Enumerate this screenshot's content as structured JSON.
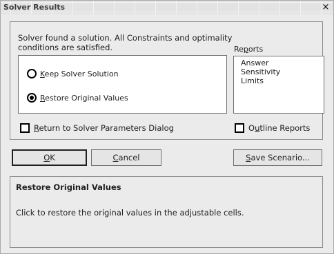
{
  "window": {
    "title": "Solver Results",
    "close_glyph": "×"
  },
  "message": {
    "line1": "Solver found a solution.  All Constraints and optimality",
    "line2": "conditions are satisfied."
  },
  "reports": {
    "label_pre": "Re",
    "label_accel": "p",
    "label_post": "orts",
    "items": [
      "Answer",
      "Sensitivity",
      "Limits"
    ]
  },
  "options": {
    "keep": {
      "accel": "K",
      "rest": "eep Solver Solution",
      "selected": false
    },
    "restore": {
      "accel": "R",
      "rest": "estore Original Values",
      "selected": true
    }
  },
  "checkboxes": {
    "return_dialog": {
      "pre": "",
      "accel": "R",
      "post": "eturn to Solver Parameters Dialog",
      "checked": false
    },
    "outline_reports": {
      "pre": "O",
      "accel": "u",
      "post": "tline Reports",
      "checked": false
    }
  },
  "buttons": {
    "ok": {
      "pre": "",
      "accel": "O",
      "post": "K"
    },
    "cancel": {
      "pre": "",
      "accel": "C",
      "post": "ancel"
    },
    "save_scenario": {
      "pre": "",
      "accel": "S",
      "post": "ave Scenario..."
    }
  },
  "description": {
    "title": "Restore Original Values",
    "text": "Click to restore the original values in the adjustable cells."
  }
}
